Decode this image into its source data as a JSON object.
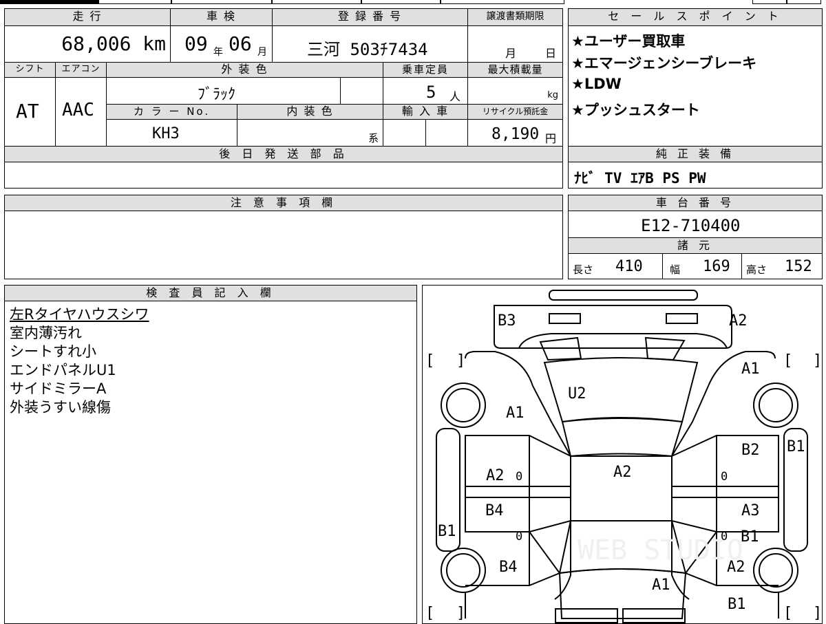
{
  "top_strip": {},
  "mileage": {
    "header": "走 行",
    "value": "68,006 km"
  },
  "inspection": {
    "header": "車 検",
    "year": "09",
    "year_unit": "年",
    "month": "06",
    "month_unit": "月"
  },
  "registration": {
    "header": "登 録 番 号",
    "value": "三河 503ﾁ7434"
  },
  "transfer_deadline": {
    "header": "譲渡書類期限",
    "month_unit": "月",
    "day_unit": "日"
  },
  "shift": {
    "header": "シフト",
    "value": "AT"
  },
  "aircon": {
    "header": "エアコン",
    "value": "AAC"
  },
  "exterior_color": {
    "header": "外 装 色",
    "value": "ﾌﾞﾗｯｸ"
  },
  "capacity": {
    "header": "乗車定員",
    "value": "5",
    "unit": "人"
  },
  "max_load": {
    "header": "最大積載量",
    "unit": "kg"
  },
  "color_no": {
    "header": "カ ラ ー No.",
    "value": "KH3"
  },
  "interior_color": {
    "header": "内 装 色",
    "suffix": "系"
  },
  "import": {
    "header": "輸 入 車"
  },
  "recycle": {
    "header": "リサイクル預託金",
    "value": "8,190",
    "unit": "円"
  },
  "parts_later": {
    "header": "後 日 発 送 部 品"
  },
  "sales_points": {
    "header": "セ ー ル ス ポ イ ン ト",
    "items": [
      "★ユーザー買取車",
      "★エマージェンシーブレーキ",
      "★LDW",
      "★プッシュスタート"
    ]
  },
  "genuine_equipment": {
    "header": "純 正 装 備",
    "value": "ﾅﾋﾞ TV ｴｱB PS PW"
  },
  "notes": {
    "header": "注 意 事 項 欄"
  },
  "chassis": {
    "header": "車 台 番 号",
    "value": "E12-710400"
  },
  "specs": {
    "header": "諸 元",
    "length_label": "長さ",
    "length": "410",
    "width_label": "幅",
    "width": "169",
    "height_label": "高さ",
    "height": "152"
  },
  "inspector": {
    "header": "検 査 員 記 入 欄",
    "lines": [
      "左Rタイヤハウスシワ",
      "室内薄汚れ",
      "シートすれ小",
      "エンドパネルU1",
      "サイドミラーA",
      "外装うすい線傷"
    ]
  },
  "diagram": {
    "marks": {
      "b3": "B3",
      "a2_top": "A2",
      "a1_right": "A1",
      "u2": "U2",
      "a1_left": "A1",
      "b1_right_top": "B1",
      "b2": "B2",
      "a2_left": "A2",
      "a2_center": "A2",
      "zero1": "0",
      "zero2": "0",
      "b4": "B4",
      "a3": "A3",
      "b1_left": "B1",
      "zero3": "0",
      "zero4": "0",
      "b1_right_mid": "B1",
      "b4_low": "B4",
      "a2_right_low": "A2",
      "a1_bottom": "A1",
      "b1_bottom": "B1"
    },
    "brackets": {
      "l": "[",
      "r": "]"
    },
    "watermark": "WEB STUDIO"
  }
}
